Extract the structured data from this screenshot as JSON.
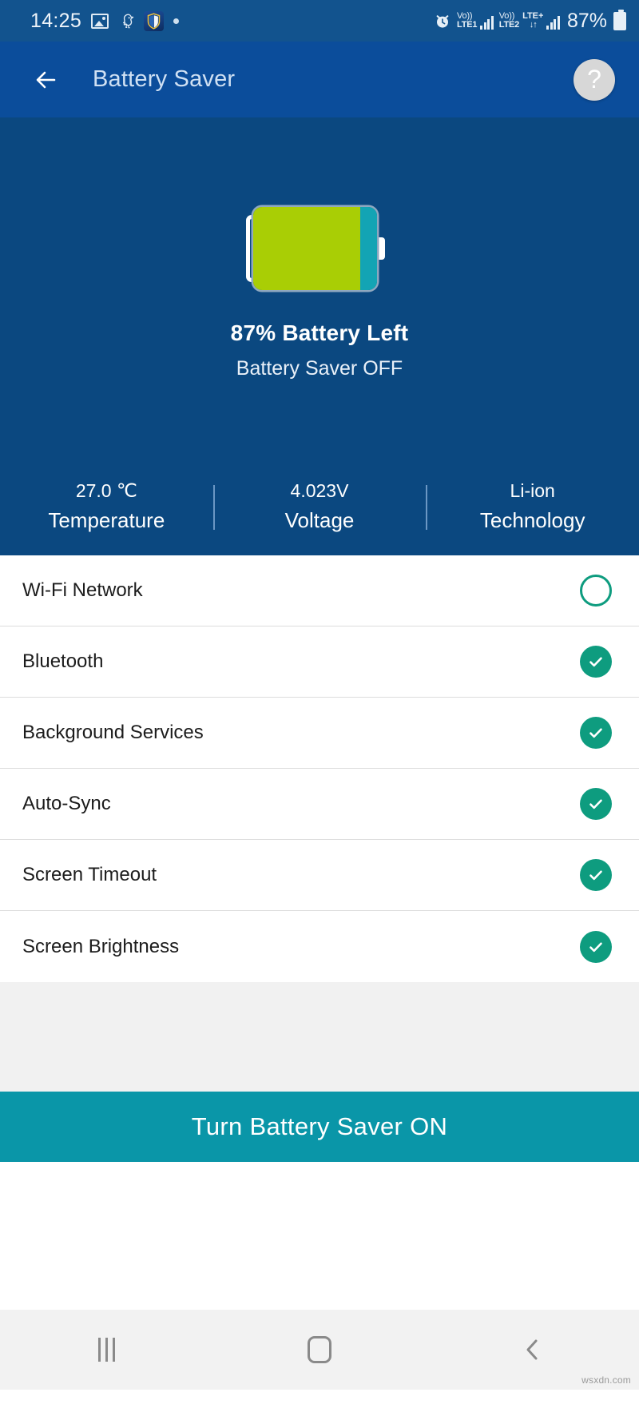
{
  "status_bar": {
    "clock": "14:25",
    "icons_left": [
      "image-icon",
      "bird-icon",
      "security-shield-icon",
      "dot-indicator-icon"
    ],
    "alarm_icon": "alarm-icon",
    "sim1": {
      "volte": "Vo))",
      "network": "LTE1"
    },
    "sim2": {
      "volte": "Vo))",
      "network": "LTE2",
      "data": "LTE+",
      "arrows": "↓↑"
    },
    "battery_percent": "87%",
    "battery_icon": "battery-icon"
  },
  "app_bar": {
    "back_icon": "back-arrow-icon",
    "title": "Battery Saver",
    "help_label": "?",
    "help_icon": "help-icon"
  },
  "hero": {
    "battery_graphic": "battery-large-icon",
    "battery_level": 87,
    "fill_color": "#A9CE05",
    "empty_color": "#13A4B4",
    "percent_text": "87%",
    "percent_suffix": "Battery Left",
    "saver_status": "Battery Saver OFF",
    "stats": [
      {
        "value": "27.0 ℃",
        "label": "Temperature"
      },
      {
        "value": "4.023V",
        "label": "Voltage"
      },
      {
        "value": "Li-ion",
        "label": "Technology"
      }
    ]
  },
  "toggles": [
    {
      "label": "Wi-Fi Network",
      "checked": false
    },
    {
      "label": "Bluetooth",
      "checked": true
    },
    {
      "label": "Background Services",
      "checked": true
    },
    {
      "label": "Auto-Sync",
      "checked": true
    },
    {
      "label": "Screen Timeout",
      "checked": true
    },
    {
      "label": "Screen Brightness",
      "checked": true
    }
  ],
  "cta": {
    "label": "Turn Battery Saver ON",
    "color": "#0A96A8"
  },
  "nav_bar": {
    "recents_icon": "recents-icon",
    "home_icon": "home-icon",
    "back_icon": "back-chevron-icon"
  },
  "watermark": "wsxdn.com",
  "theme": {
    "status_bar_bg": "#12538E",
    "app_bar_bg": "#0B4D9B",
    "hero_bg": "#0B4880",
    "accent_check": "#0E9C7F",
    "cta_bg": "#0A96A8"
  }
}
